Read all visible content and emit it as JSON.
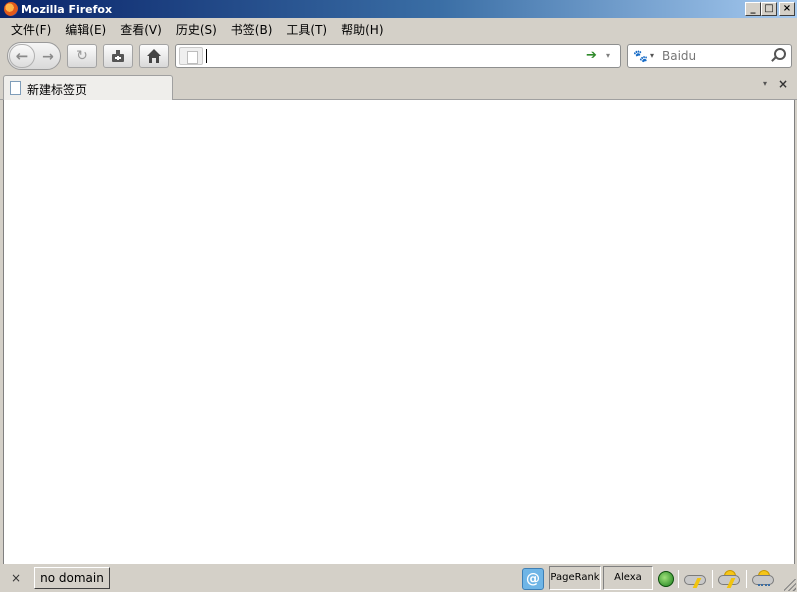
{
  "window": {
    "title": "Mozilla Firefox",
    "controls": [
      "_",
      "□",
      "×"
    ]
  },
  "menu": [
    "文件(F)",
    "编辑(E)",
    "查看(V)",
    "历史(S)",
    "书签(B)",
    "工具(T)",
    "帮助(H)"
  ],
  "toolbar": {
    "back_icon": "←",
    "forward_icon": "→",
    "reload_icon": "↻",
    "home_icon": "⌂",
    "url_value": "",
    "go_icon": "➔",
    "url_dropdown_icon": "▾",
    "search_engine_icon": "🐾",
    "search_placeholder": "Baidu"
  },
  "tabs": [
    {
      "label": "新建标签页",
      "active": true
    }
  ],
  "tabstrip": {
    "list_icon": "▾",
    "close_icon": "×"
  },
  "statusbar": {
    "close_icon": "×",
    "domain": "no domain",
    "at_icon": "@",
    "pagerank": "PageRank",
    "alexa": "Alexa"
  }
}
